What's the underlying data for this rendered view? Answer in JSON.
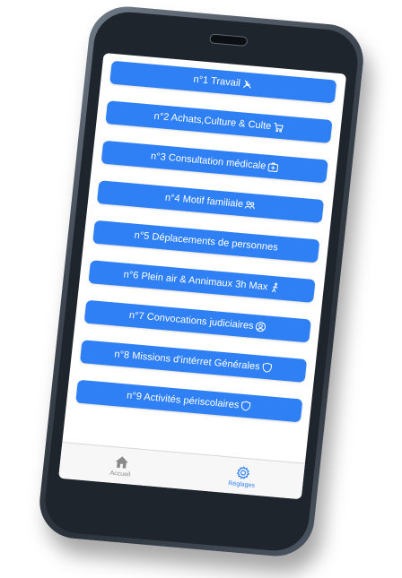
{
  "buttons": [
    {
      "label": "n°1 Travail",
      "icon": "tools-icon"
    },
    {
      "label": "n°2 Achats,Culture & Culte",
      "icon": "cart-icon"
    },
    {
      "label": "n°3 Consultation médicale",
      "icon": "medical-bag-icon"
    },
    {
      "label": "n°4 Motif familiale",
      "icon": "family-icon"
    },
    {
      "label": "n°5 Déplacements de personnes",
      "icon": ""
    },
    {
      "label": "n°6 Plein air & Annimaux 3h Max",
      "icon": "walking-person-icon"
    },
    {
      "label": "n°7 Convocations judiciaires",
      "icon": "judge-icon"
    },
    {
      "label": "n°8 Missions d'intérret Générales",
      "icon": "shield-icon"
    },
    {
      "label": "n°9 Activités périscolaires",
      "icon": "shield-icon"
    }
  ],
  "tabbar": {
    "home_label": "Accueil",
    "settings_label": "Réglages"
  },
  "colors": {
    "accent": "#2f80f5",
    "phone_frame": "#3f4853",
    "tab_inactive": "#8a8a8a"
  }
}
